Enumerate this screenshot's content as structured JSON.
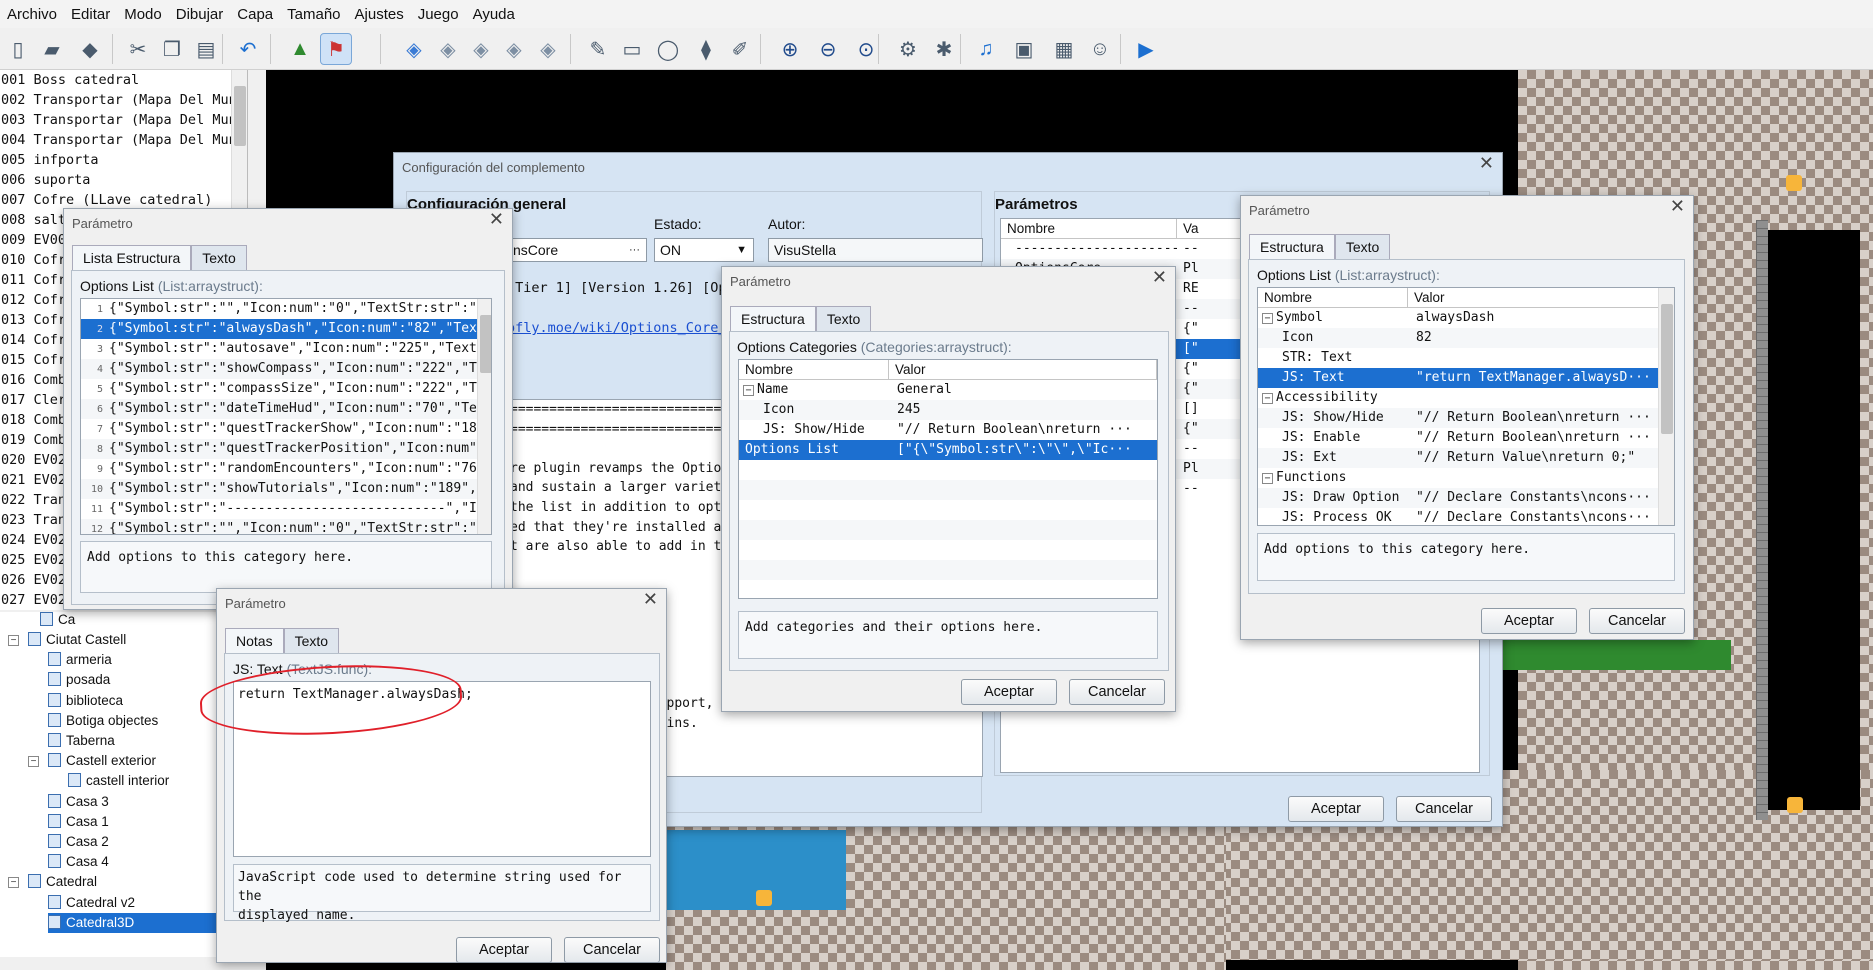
{
  "menu": [
    "Archivo",
    "Editar",
    "Modo",
    "Dibujar",
    "Capa",
    "Tamaño",
    "Ajustes",
    "Juego",
    "Ayuda"
  ],
  "toolbar_icons": [
    "new-project-icon",
    "open-project-icon",
    "save-project-icon",
    "cut-icon",
    "copy-icon",
    "paste-icon",
    "undo-icon",
    "map-mode-icon",
    "event-mode-icon",
    "layer-a-icon",
    "layer-b-icon",
    "layer-c-icon",
    "layer-d-icon",
    "layer-auto-icon",
    "pencil-icon",
    "rectangle-icon",
    "ellipse-icon",
    "flood-fill-icon",
    "shadow-pen-icon",
    "zoom-in-icon",
    "zoom-out-icon",
    "zoom-actual-icon",
    "database-icon",
    "plugin-manager-icon",
    "sound-test-icon",
    "event-searcher-icon",
    "resource-manager-icon",
    "character-generator-icon",
    "playtest-icon"
  ],
  "event_list": [
    "001 Boss catedral",
    "002 Transportar (Mapa Del Mundo)",
    "003 Transportar (Mapa Del Mundo)",
    "004 Transportar (Mapa Del Mundo)",
    "005 infporta",
    "006 suporta",
    "007 Cofre (LLave catedral)",
    "008 salto",
    "009 EV009",
    "010 Cofre",
    "011 Cofre",
    "012 Cofre",
    "013 Cofre",
    "014 Cofre",
    "015 Cofre",
    "016 Comba",
    "017 Cler",
    "018 Comba",
    "019 Comba",
    "020 EV020",
    "021 EV021",
    "022 Trans",
    "023 Trans",
    "024 EV024",
    "025 EV025",
    "026 EV026",
    "027 EV027"
  ],
  "map_tree": {
    "partial": [
      "Ca"
    ],
    "items": [
      {
        "label": "Ciutat Castell",
        "level": 0,
        "expanded": true
      },
      {
        "label": "armeria",
        "level": 1
      },
      {
        "label": "posada",
        "level": 1
      },
      {
        "label": "biblioteca",
        "level": 1
      },
      {
        "label": "Botiga objectes",
        "level": 1
      },
      {
        "label": "Taberna",
        "level": 1
      },
      {
        "label": "Castell exterior",
        "level": 1,
        "expanded": true
      },
      {
        "label": "castell interior",
        "level": 2
      },
      {
        "label": "Casa 3",
        "level": 1
      },
      {
        "label": "Casa 1",
        "level": 1
      },
      {
        "label": "Casa 2",
        "level": 1
      },
      {
        "label": "Casa 4",
        "level": 1
      },
      {
        "label": "Catedral",
        "level": 0,
        "expanded": true
      },
      {
        "label": "Catedral v2",
        "level": 1
      },
      {
        "label": "Catedral3D",
        "level": 1,
        "selected": true
      }
    ]
  },
  "plugin_config": {
    "title": "Configuración del complemento",
    "general_title": "Configuración general",
    "state_label": "Estado:",
    "author_label": "Autor:",
    "name_value": "nsCore",
    "state_value": "ON",
    "author_value": "VisuStella",
    "tier_text": "[Tier 1] [Version 1.26] [Opt",
    "help_link": "ofly.moe/wiki/Options_Core_Vis",
    "help_lines": [
      "============================================",
      "============================================",
      "",
      "re plugin revamps the Options",
      "and sustain a larger variety",
      "the list in addition to opti",
      "ed that they're installed as",
      "t are also able to add in the",
      "",
      "",
      "d to) th",
      "",
      "yout.",
      "egories",
      "",
      "lume, Window Tone support, and more.",
      "r VisuStella MZ plugins."
    ],
    "params_title": "Parámetros",
    "params_header": [
      "Nombre",
      "Va"
    ],
    "params_rows": [
      [
        "-----------------------",
        "--"
      ],
      [
        "OptionsCore",
        "Pl"
      ],
      [
        "",
        "RE"
      ],
      [
        "",
        "--"
      ],
      [
        "",
        "{\""
      ],
      [
        "",
        "[\""
      ],
      [
        "",
        "{\""
      ],
      [
        "ebind",
        "{\""
      ],
      [
        "",
        "[]"
      ],
      [
        "t",
        "{\""
      ],
      [
        "",
        "--"
      ],
      [
        "",
        "Pl"
      ],
      [
        "",
        "--"
      ]
    ],
    "ok": "Aceptar",
    "cancel": "Cancelar"
  },
  "dlg_list": {
    "title": "Parámetro",
    "tabs": [
      "Lista Estructura",
      "Texto"
    ],
    "label": "Options List",
    "type": "(List:arraystruct):",
    "rows": [
      "{\"Symbol:str\":\"\",\"Icon:num\":\"0\",\"TextStr:str\":\"\\\\C",
      "{\"Symbol:str\":\"alwaysDash\",\"Icon:num\":\"82\",\"TextSt",
      "{\"Symbol:str\":\"autosave\",\"Icon:num\":\"225\",\"TextStr",
      "{\"Symbol:str\":\"showCompass\",\"Icon:num\":\"222\",\"Text",
      "{\"Symbol:str\":\"compassSize\",\"Icon:num\":\"222\",\"Text",
      "{\"Symbol:str\":\"dateTimeHud\",\"Icon:num\":\"70\",\"TextS",
      "{\"Symbol:str\":\"questTrackerShow\",\"Icon:num\":\"186\",",
      "{\"Symbol:str\":\"questTrackerPosition\",\"Icon:num\":\"1",
      "{\"Symbol:str\":\"randomEncounters\",\"Icon:num\":\"76\",",
      "{\"Symbol:str\":\"showTutorials\",\"Icon:num\":\"189\",\"Te",
      "{\"Symbol:str\":\"----------------------------\",\"Ico",
      "{\"Symbol:str\":\"\",\"Icon:num\":\"0\",\"TextStr:str\":\"\\\\C"
    ],
    "selected": 1,
    "description": "Add options to this category here."
  },
  "dlg_text": {
    "title": "Parámetro",
    "tabs": [
      "Notas",
      "Texto"
    ],
    "label": "JS: Text",
    "type": "(TextJS:func):",
    "code": "return TextManager.alwaysDash;",
    "description_lines": [
      "JavaScript code used to determine string used for the",
      "displayed name."
    ],
    "ok": "Aceptar",
    "cancel": "Cancelar"
  },
  "dlg_categories": {
    "title": "Parámetro",
    "tabs": [
      "Estructura",
      "Texto"
    ],
    "label": "Options Categories",
    "type": "(Categories:arraystruct):",
    "header": [
      "Nombre",
      "Valor"
    ],
    "rows": [
      {
        "name": "Name",
        "value": "General",
        "indent": 0,
        "group": true
      },
      {
        "name": "Icon",
        "value": "245",
        "indent": 1
      },
      {
        "name": "JS: Show/Hide",
        "value": "\"// Return Boolean\\nreturn ···",
        "indent": 1
      },
      {
        "name": "Options List",
        "value": "[\"{\\\"Symbol:str\\\":\\\"\\\",\\\"Ic···",
        "indent": 0,
        "selected": true
      }
    ],
    "description": "Add categories and their options here.",
    "ok": "Aceptar",
    "cancel": "Cancelar"
  },
  "dlg_struct": {
    "title": "Parámetro",
    "tabs": [
      "Estructura",
      "Texto"
    ],
    "label": "Options List",
    "type": "(List:arraystruct):",
    "header": [
      "Nombre",
      "Valor"
    ],
    "rows": [
      {
        "name": "Symbol",
        "value": "alwaysDash",
        "indent": 0,
        "group": true
      },
      {
        "name": "Icon",
        "value": "82",
        "indent": 1
      },
      {
        "name": "STR: Text",
        "value": "",
        "indent": 1
      },
      {
        "name": "JS: Text",
        "value": "\"return TextManager.alwaysD···",
        "indent": 1,
        "selected": true
      },
      {
        "name": "Accessibility",
        "value": "",
        "indent": 0,
        "group": true
      },
      {
        "name": "JS: Show/Hide",
        "value": "\"// Return Boolean\\nreturn ···",
        "indent": 1
      },
      {
        "name": "JS: Enable",
        "value": "\"// Return Boolean\\nreturn ···",
        "indent": 1
      },
      {
        "name": "JS: Ext",
        "value": "\"// Return Value\\nreturn 0;\"",
        "indent": 1
      },
      {
        "name": "Functions",
        "value": "",
        "indent": 0,
        "group": true
      },
      {
        "name": "JS: Draw Option",
        "value": "\"// Declare Constants\\ncons···",
        "indent": 1
      },
      {
        "name": "JS: Process OK",
        "value": "\"// Declare Constants\\ncons···",
        "indent": 1
      }
    ],
    "description": "Add options to this category here.",
    "ok": "Aceptar",
    "cancel": "Cancelar"
  },
  "colors": {
    "selection": "#1c6fd0",
    "annotation": "#e0202a",
    "dialog_blue": "#d6e4f3"
  }
}
